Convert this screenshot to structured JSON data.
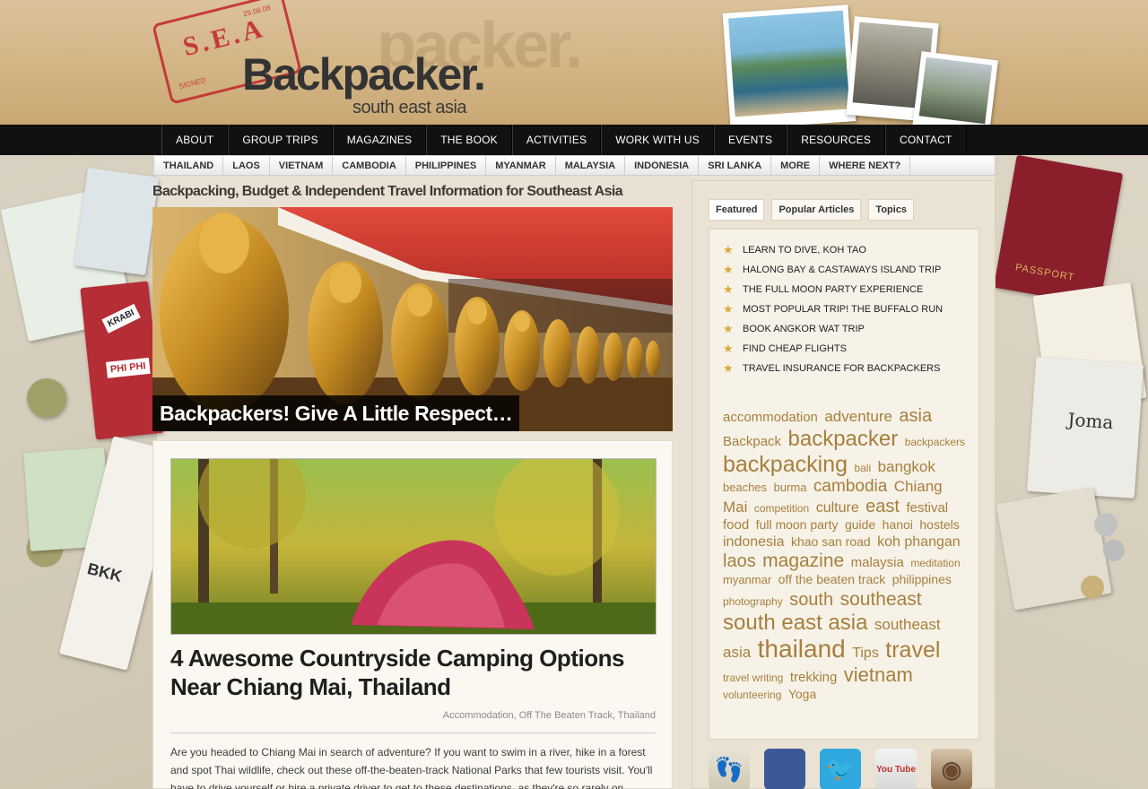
{
  "header": {
    "stamp_text": "S.E.A",
    "stamp_signed": "SIGNED",
    "stamp_date": "29.08.08",
    "logo_main": "Backpacker.",
    "logo_sub": "south east asia"
  },
  "top_nav": [
    "ABOUT",
    "GROUP TRIPS",
    "MAGAZINES",
    "THE BOOK",
    "ACTIVITIES",
    "WORK WITH US",
    "EVENTS",
    "RESOURCES",
    "CONTACT"
  ],
  "country_nav": [
    "THAILAND",
    "LAOS",
    "VIETNAM",
    "CAMBODIA",
    "PHILIPPINES",
    "MYANMAR",
    "MALAYSIA",
    "INDONESIA",
    "SRI LANKA",
    "MORE",
    "WHERE NEXT?"
  ],
  "main": {
    "tagline": "Backpacking, Budget & Independent Travel Information for Southeast Asia",
    "hero_caption": "Backpackers! Give A Little Respect…",
    "post": {
      "title": "4 Awesome Countryside Camping Options Near Chiang Mai, Thailand",
      "categories": "Accommodation, Off The Beaten Track, Thailand",
      "excerpt": "Are you headed to Chiang Mai in search of adventure? If you want to swim in a river, hike in a forest and spot Thai wildlife, check out these off-the-beaten-track National Parks that few tourists visit. You'll have to drive yourself or hire a private driver to get to these destinations, as they're so rarely on"
    }
  },
  "sidebar": {
    "tabs": [
      "Featured",
      "Popular Articles",
      "Topics"
    ],
    "featured": [
      "LEARN TO DIVE, KOH TAO",
      "HALONG BAY & CASTAWAYS ISLAND TRIP",
      "THE FULL MOON PARTY EXPERIENCE",
      "MOST POPULAR TRIP! THE BUFFALO RUN",
      "BOOK ANGKOR WAT TRIP",
      "FIND CHEAP FLIGHTS",
      "TRAVEL INSURANCE FOR BACKPACKERS"
    ],
    "tags": [
      {
        "t": "accommodation",
        "s": 15
      },
      {
        "t": "adventure",
        "s": 17
      },
      {
        "t": "asia",
        "s": 20
      },
      {
        "t": "Backpack",
        "s": 15
      },
      {
        "t": "backpacker",
        "s": 24
      },
      {
        "t": "backpackers",
        "s": 12
      },
      {
        "t": "backpacking",
        "s": 25
      },
      {
        "t": "bali",
        "s": 12
      },
      {
        "t": "bangkok",
        "s": 17
      },
      {
        "t": "beaches",
        "s": 13
      },
      {
        "t": "burma",
        "s": 13
      },
      {
        "t": "cambodia",
        "s": 19
      },
      {
        "t": "Chiang Mai",
        "s": 17
      },
      {
        "t": "competition",
        "s": 12
      },
      {
        "t": "culture",
        "s": 16
      },
      {
        "t": "east",
        "s": 20
      },
      {
        "t": "festival",
        "s": 15
      },
      {
        "t": "food",
        "s": 15
      },
      {
        "t": "full moon party",
        "s": 14
      },
      {
        "t": "guide",
        "s": 14
      },
      {
        "t": "hanoi",
        "s": 14
      },
      {
        "t": "hostels",
        "s": 14
      },
      {
        "t": "indonesia",
        "s": 16
      },
      {
        "t": "khao san road",
        "s": 14
      },
      {
        "t": "koh phangan",
        "s": 16
      },
      {
        "t": "laos",
        "s": 20
      },
      {
        "t": "magazine",
        "s": 21
      },
      {
        "t": "malaysia",
        "s": 15
      },
      {
        "t": "meditation",
        "s": 12
      },
      {
        "t": "myanmar",
        "s": 13
      },
      {
        "t": "off the beaten track",
        "s": 14
      },
      {
        "t": "philippines",
        "s": 14
      },
      {
        "t": "photography",
        "s": 12
      },
      {
        "t": "south",
        "s": 20
      },
      {
        "t": "southeast",
        "s": 21
      },
      {
        "t": "south east asia",
        "s": 24
      },
      {
        "t": "southeast asia",
        "s": 17
      },
      {
        "t": "thailand",
        "s": 28
      },
      {
        "t": "Tips",
        "s": 16
      },
      {
        "t": "travel",
        "s": 25
      },
      {
        "t": "travel writing",
        "s": 12
      },
      {
        "t": "trekking",
        "s": 15
      },
      {
        "t": "vietnam",
        "s": 22
      },
      {
        "t": "volunteering",
        "s": 12
      },
      {
        "t": "Yoga",
        "s": 14
      }
    ],
    "social": [
      {
        "name": "footprint",
        "label": "👣",
        "color": "#2f6f2f"
      },
      {
        "name": "facebook",
        "label": "f",
        "color": "#3b5998"
      },
      {
        "name": "twitter",
        "label": "🐦",
        "color": "#ffffff"
      },
      {
        "name": "youtube",
        "label": "You Tube",
        "color": "#ffffff"
      },
      {
        "name": "instagram",
        "label": "◉",
        "color": "#6b4a2f"
      }
    ]
  },
  "scrapbook": {
    "cards": [
      "KRABI",
      "PHI PHI",
      "BKK",
      "PASSPORT",
      "Joma"
    ]
  }
}
